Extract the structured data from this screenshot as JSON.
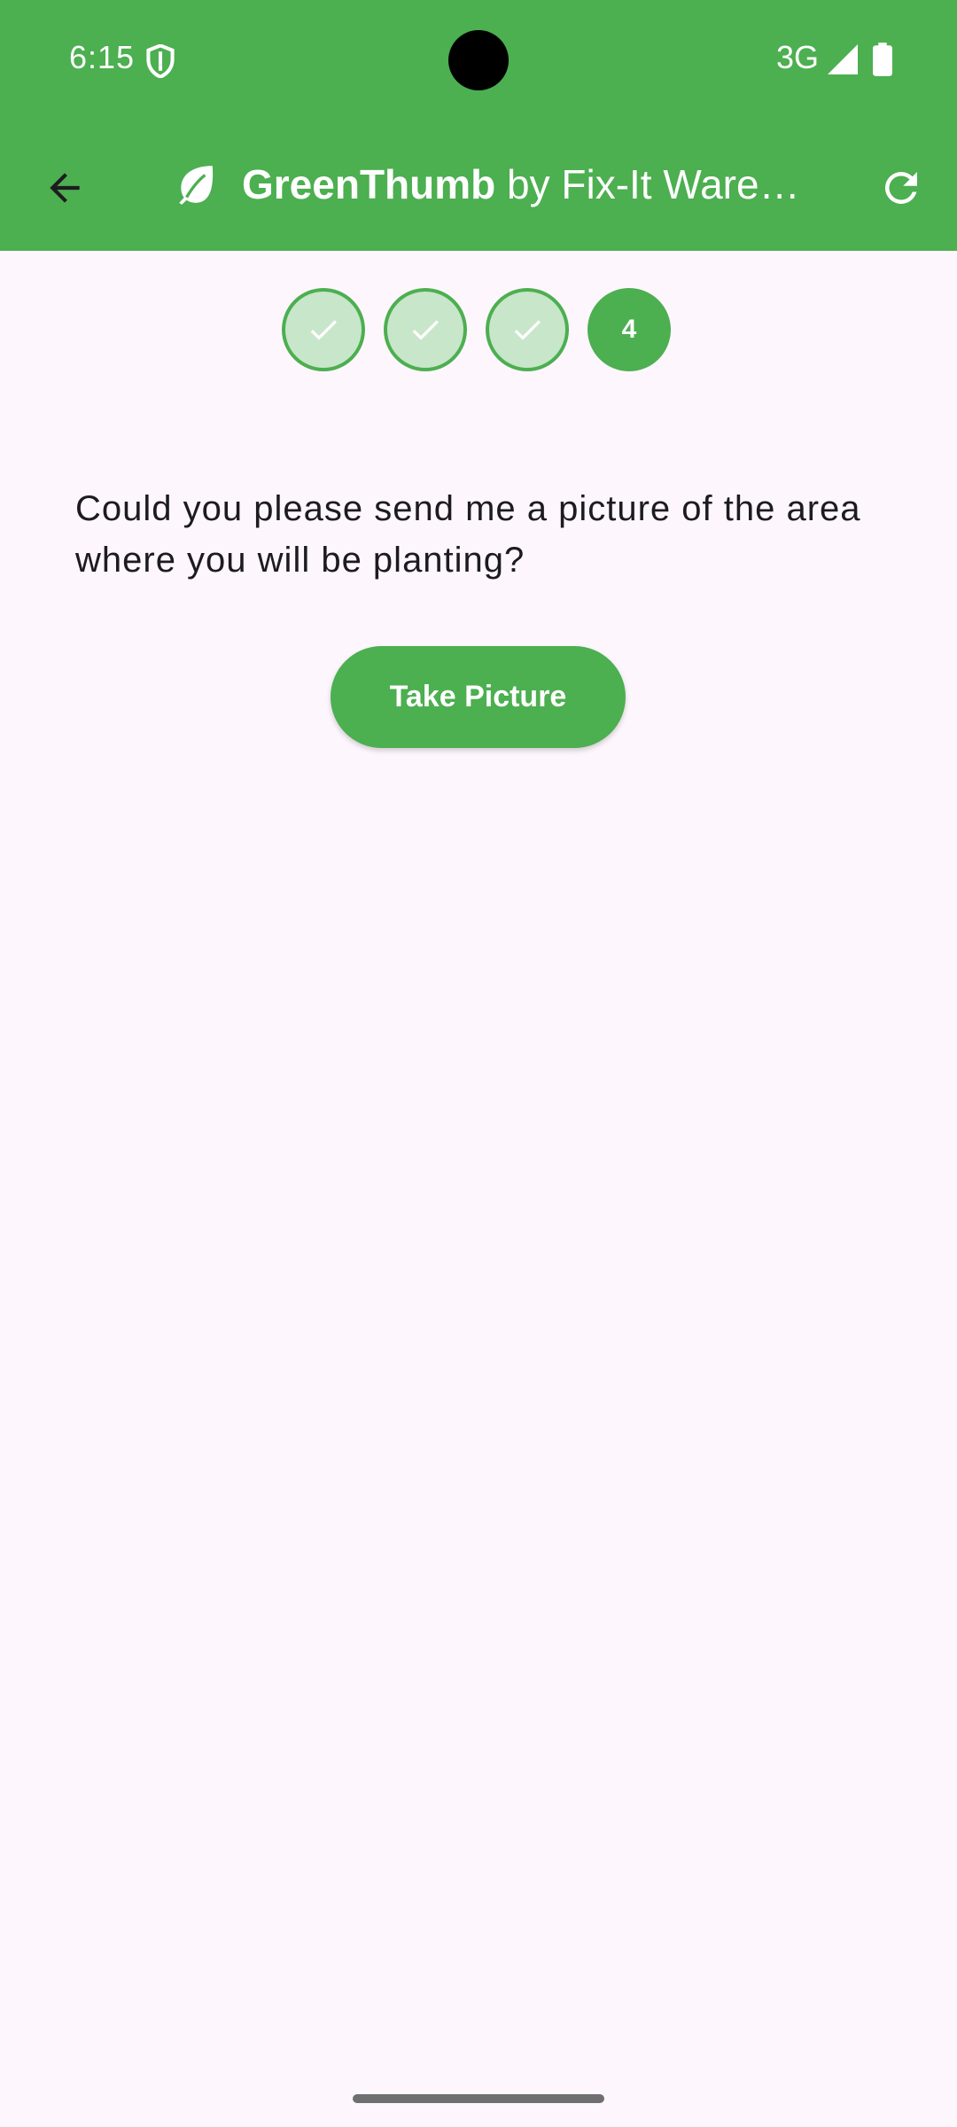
{
  "status_bar": {
    "time": "6:15",
    "network": "3G"
  },
  "app_bar": {
    "title_bold": "GreenThumb",
    "title_rest": " by Fix-It Warehouse"
  },
  "steps": [
    {
      "state": "done"
    },
    {
      "state": "done"
    },
    {
      "state": "done"
    },
    {
      "state": "current",
      "label": "4"
    }
  ],
  "question": "Could you please send me a picture of the area where you will be planting?",
  "take_picture_label": "Take Picture",
  "colors": {
    "primary": "#4caf50",
    "step_done_fill": "#c8e6c9",
    "background": "#fdf6fd"
  }
}
